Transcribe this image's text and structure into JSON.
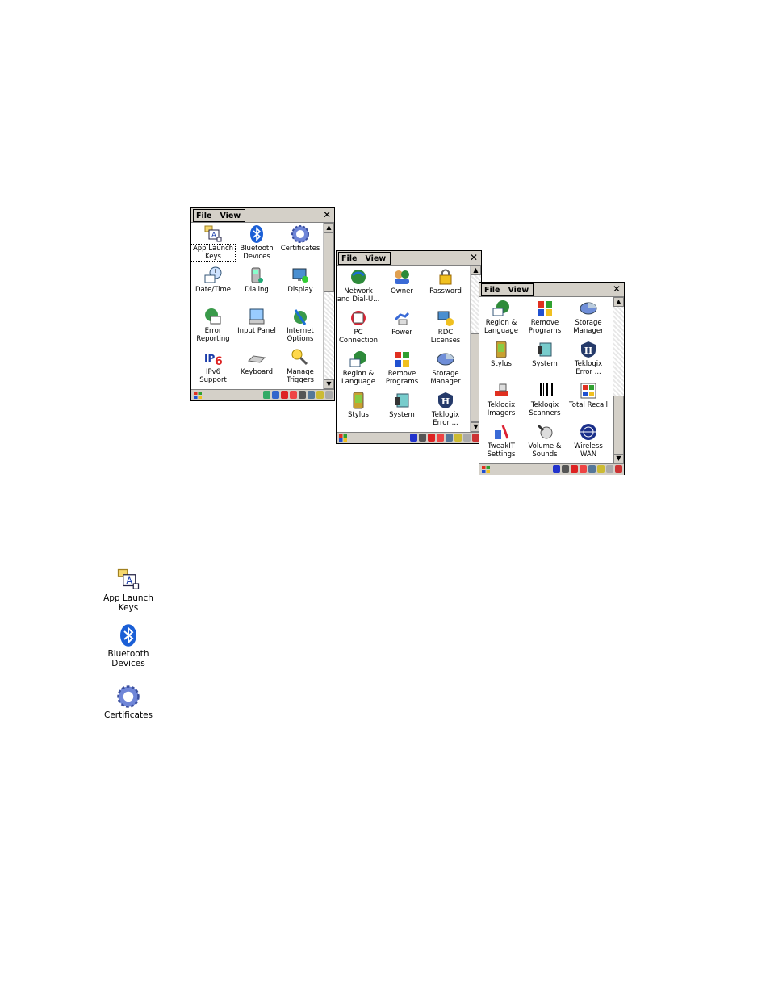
{
  "windows": [
    {
      "menu": [
        "File",
        "View"
      ],
      "close": "✕",
      "items": [
        {
          "label": "App Launch\nKeys",
          "icon": "app-launch-keys-icon",
          "selected": true
        },
        {
          "label": "Bluetooth\nDevices",
          "icon": "bluetooth-icon"
        },
        {
          "label": "Certificates",
          "icon": "certificates-icon"
        },
        {
          "label": "Date/Time",
          "icon": "date-time-icon"
        },
        {
          "label": "Dialing",
          "icon": "dialing-icon"
        },
        {
          "label": "Display",
          "icon": "display-icon"
        },
        {
          "label": "Error\nReporting",
          "icon": "error-reporting-icon"
        },
        {
          "label": "Input Panel",
          "icon": "input-panel-icon"
        },
        {
          "label": "Internet\nOptions",
          "icon": "internet-options-icon"
        },
        {
          "label": "IPv6\nSupport",
          "icon": "ipv6-icon"
        },
        {
          "label": "Keyboard",
          "icon": "keyboard-icon"
        },
        {
          "label": "Manage\nTriggers",
          "icon": "manage-triggers-icon"
        }
      ]
    },
    {
      "menu": [
        "File",
        "View"
      ],
      "close": "✕",
      "items": [
        {
          "label": "Network\nand Dial-U...",
          "icon": "network-icon"
        },
        {
          "label": "Owner",
          "icon": "owner-icon"
        },
        {
          "label": "Password",
          "icon": "password-icon"
        },
        {
          "label": "PC\nConnection",
          "icon": "pc-connection-icon"
        },
        {
          "label": "Power",
          "icon": "power-icon"
        },
        {
          "label": "RDC\nLicenses",
          "icon": "rdc-licenses-icon"
        },
        {
          "label": "Region &\nLanguage",
          "icon": "region-language-icon"
        },
        {
          "label": "Remove\nPrograms",
          "icon": "remove-programs-icon"
        },
        {
          "label": "Storage\nManager",
          "icon": "storage-manager-icon"
        },
        {
          "label": "Stylus",
          "icon": "stylus-icon"
        },
        {
          "label": "System",
          "icon": "system-icon"
        },
        {
          "label": "Teklogix\nError ...",
          "icon": "teklogix-error-icon"
        }
      ]
    },
    {
      "menu": [
        "File",
        "View"
      ],
      "close": "✕",
      "items": [
        {
          "label": "Region &\nLanguage",
          "icon": "region-language-icon"
        },
        {
          "label": "Remove\nPrograms",
          "icon": "remove-programs-icon"
        },
        {
          "label": "Storage\nManager",
          "icon": "storage-manager-icon"
        },
        {
          "label": "Stylus",
          "icon": "stylus-icon"
        },
        {
          "label": "System",
          "icon": "system-icon"
        },
        {
          "label": "Teklogix\nError ...",
          "icon": "teklogix-error-icon"
        },
        {
          "label": "Teklogix\nImagers",
          "icon": "teklogix-imagers-icon"
        },
        {
          "label": "Teklogix\nScanners",
          "icon": "teklogix-scanners-icon"
        },
        {
          "label": "Total Recall",
          "icon": "total-recall-icon"
        },
        {
          "label": "TweakIT\nSettings",
          "icon": "tweakit-settings-icon"
        },
        {
          "label": "Volume &\nSounds",
          "icon": "volume-sounds-icon"
        },
        {
          "label": "Wireless\nWAN",
          "icon": "wireless-wan-icon"
        }
      ]
    }
  ],
  "standalone": [
    {
      "label": "App Launch\nKeys",
      "icon": "app-launch-keys-icon"
    },
    {
      "label": "Bluetooth\nDevices",
      "icon": "bluetooth-icon"
    },
    {
      "label": "Certificates",
      "icon": "certificates-icon"
    }
  ]
}
